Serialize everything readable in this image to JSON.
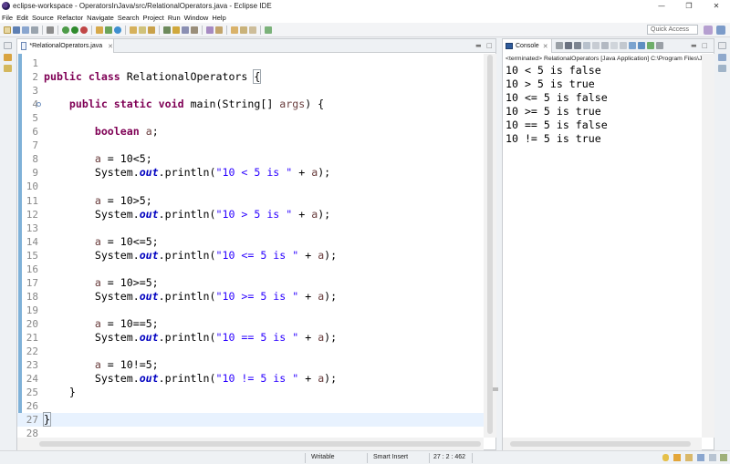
{
  "window": {
    "title": "eclipse-workspace - OperatorsInJava/src/RelationalOperators.java - Eclipse IDE",
    "minimize": "—",
    "maximize": "❐",
    "close": "✕"
  },
  "menu": [
    "File",
    "Edit",
    "Source",
    "Refactor",
    "Navigate",
    "Search",
    "Project",
    "Run",
    "Window",
    "Help"
  ],
  "toolbar": {
    "quick_access_placeholder": "Quick Access"
  },
  "editor": {
    "tab_label": "*RelationalOperators.java",
    "tab_close": "✕",
    "current_line": 27,
    "lines": [
      {
        "n": "1",
        "html": ""
      },
      {
        "n": "2",
        "html": "<span class=\"kw\">public</span> <span class=\"kw\">class</span> RelationalOperators <span class=\"rb\">{</span>"
      },
      {
        "n": "3",
        "html": ""
      },
      {
        "n": "4",
        "html": "    <span class=\"kw\">public</span> <span class=\"kw\">static</span> <span class=\"kw\">void</span> main(String[] <span class=\"vr\">args</span>) {",
        "fold": true
      },
      {
        "n": "5",
        "html": ""
      },
      {
        "n": "6",
        "html": "        <span class=\"kw\">boolean</span> <span class=\"vr\">a</span>;"
      },
      {
        "n": "7",
        "html": ""
      },
      {
        "n": "8",
        "html": "        <span class=\"vr\">a</span> = 10&lt;5;"
      },
      {
        "n": "9",
        "html": "        System.<span class=\"fld\">out</span>.println(<span class=\"str\">\"10 &lt; 5 is \"</span> + <span class=\"vr\">a</span>);"
      },
      {
        "n": "10",
        "html": ""
      },
      {
        "n": "11",
        "html": "        <span class=\"vr\">a</span> = 10&gt;5;"
      },
      {
        "n": "12",
        "html": "        System.<span class=\"fld\">out</span>.println(<span class=\"str\">\"10 &gt; 5 is \"</span> + <span class=\"vr\">a</span>);"
      },
      {
        "n": "13",
        "html": ""
      },
      {
        "n": "14",
        "html": "        <span class=\"vr\">a</span> = 10&lt;=5;"
      },
      {
        "n": "15",
        "html": "        System.<span class=\"fld\">out</span>.println(<span class=\"str\">\"10 &lt;= 5 is \"</span> + <span class=\"vr\">a</span>);"
      },
      {
        "n": "16",
        "html": ""
      },
      {
        "n": "17",
        "html": "        <span class=\"vr\">a</span> = 10&gt;=5;"
      },
      {
        "n": "18",
        "html": "        System.<span class=\"fld\">out</span>.println(<span class=\"str\">\"10 &gt;= 5 is \"</span> + <span class=\"vr\">a</span>);"
      },
      {
        "n": "19",
        "html": ""
      },
      {
        "n": "20",
        "html": "        <span class=\"vr\">a</span> = 10==5;"
      },
      {
        "n": "21",
        "html": "        System.<span class=\"fld\">out</span>.println(<span class=\"str\">\"10 == 5 is \"</span> + <span class=\"vr\">a</span>);"
      },
      {
        "n": "22",
        "html": ""
      },
      {
        "n": "23",
        "html": "        <span class=\"vr\">a</span> = 10!=5;"
      },
      {
        "n": "24",
        "html": "        System.<span class=\"fld\">out</span>.println(<span class=\"str\">\"10 != 5 is \"</span> + <span class=\"vr\">a</span>);"
      },
      {
        "n": "25",
        "html": "    }"
      },
      {
        "n": "26",
        "html": ""
      },
      {
        "n": "27",
        "html": "<span class=\"rb\">}</span>"
      },
      {
        "n": "28",
        "html": ""
      }
    ]
  },
  "console": {
    "tab_label": "Console",
    "tab_close": "✕",
    "status": "<terminated> RelationalOperators [Java Application] C:\\Program Files\\Java",
    "output": [
      "10 < 5 is false",
      "10 > 5 is true",
      "10 <= 5 is false",
      "10 >= 5 is true",
      "10 == 5 is false",
      "10 != 5 is true"
    ]
  },
  "statusbar": {
    "mode": "Writable",
    "insert": "Smart Insert",
    "position": "27 : 2 : 462"
  },
  "colors": {
    "keyword": "#7f0055",
    "string": "#2a00ff",
    "field": "#0000c0",
    "local_var": "#6a3e3e",
    "current_line": "#e8f2fe",
    "ruler": "#7fb1d8"
  }
}
